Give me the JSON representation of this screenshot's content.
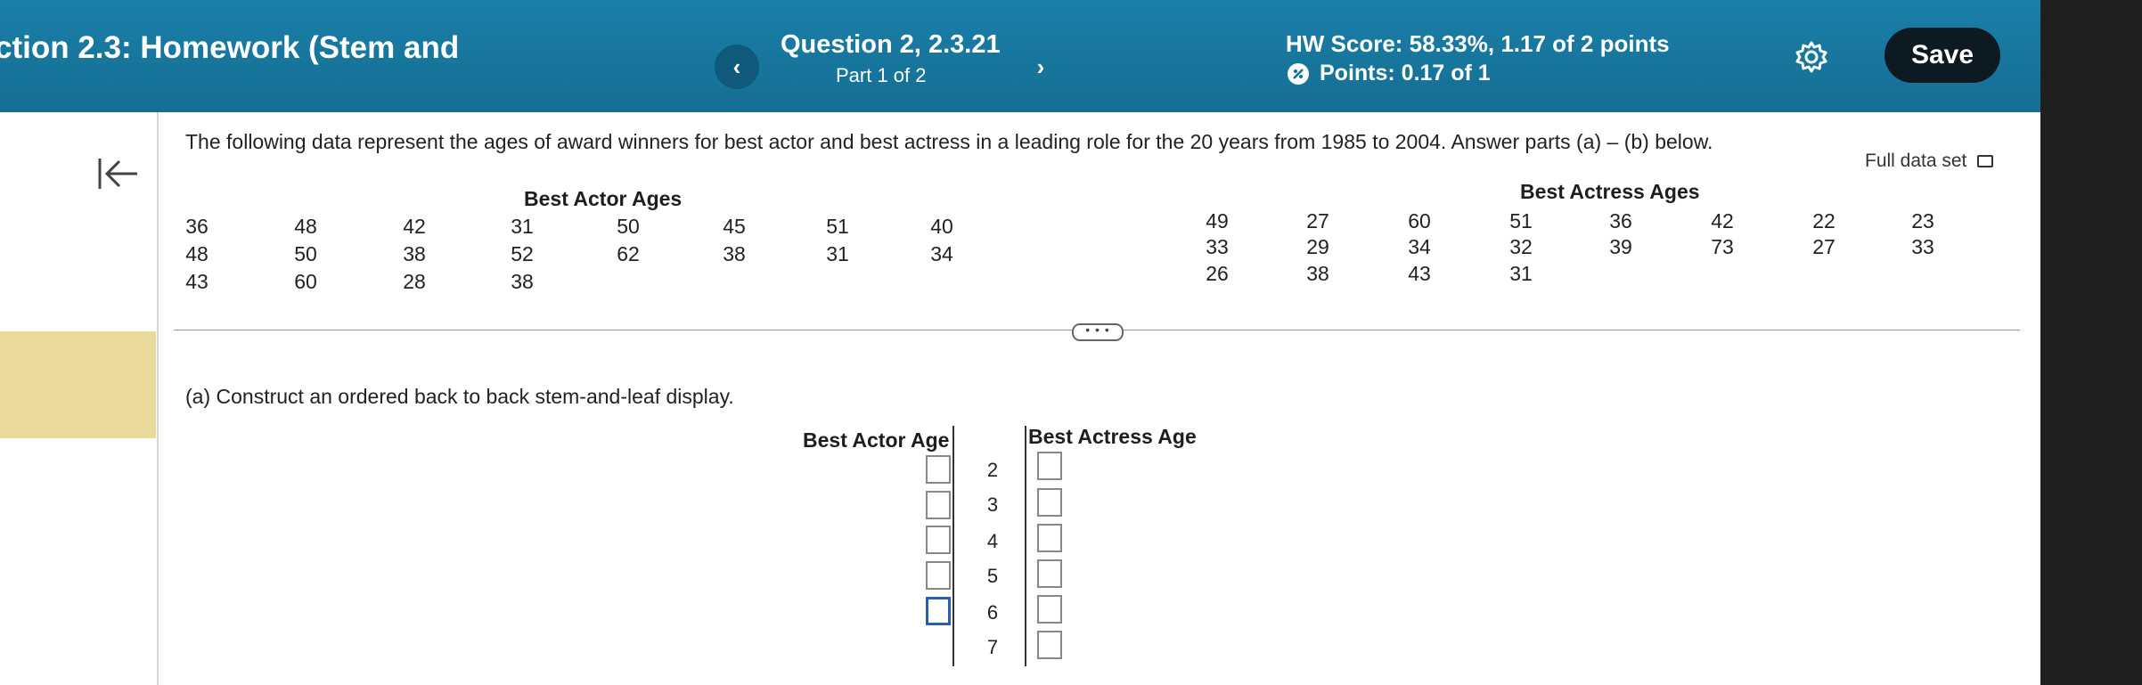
{
  "header": {
    "section_title": "ction 2.3: Homework (Stem and",
    "question_title": "Question 2, 2.3.21",
    "part": "Part 1 of 2",
    "hw_score": "HW Score: 58.33%, 1.17 of 2 points",
    "points": "Points: 0.17 of 1",
    "save_label": "Save",
    "prev_icon": "‹",
    "next_icon": "›"
  },
  "content": {
    "question_text": "The following data represent the ages of award winners for best actor and best actress in a leading role for the 20 years from 1985 to 2004. Answer parts (a) – (b) below.",
    "full_data_label": "Full data set",
    "more_label": "• • •",
    "part_a": "(a) Construct an ordered back to back stem-and-leaf display."
  },
  "actor_table": {
    "title": "Best Actor Ages",
    "rows": [
      [
        "36",
        "48",
        "42",
        "31",
        "50",
        "45",
        "51",
        "40"
      ],
      [
        "48",
        "50",
        "38",
        "52",
        "62",
        "38",
        "31",
        "34"
      ],
      [
        "43",
        "60",
        "28",
        "38"
      ]
    ]
  },
  "actress_table": {
    "title": "Best Actress Ages",
    "rows": [
      [
        "49",
        "27",
        "60",
        "51",
        "36",
        "42",
        "22",
        "23"
      ],
      [
        "33",
        "29",
        "34",
        "32",
        "39",
        "73",
        "27",
        "33"
      ],
      [
        "26",
        "38",
        "43",
        "31"
      ]
    ]
  },
  "stem_leaf": {
    "left_header": "Best Actor Age",
    "right_header": "Best Actress Age",
    "stems": [
      "2",
      "3",
      "4",
      "5",
      "6",
      "7"
    ],
    "left_leaves": [
      "",
      "",
      "",
      "",
      ""
    ],
    "right_leaves": [
      "",
      "",
      "",
      "",
      "",
      ""
    ]
  },
  "colors": {
    "header_bg": "#156e93",
    "save_bg": "#0e1a22",
    "highlight": "#eadb9c"
  }
}
